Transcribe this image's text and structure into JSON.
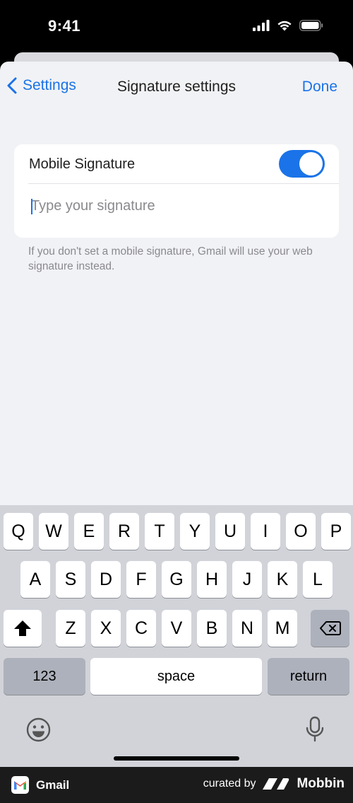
{
  "status_bar": {
    "time": "9:41"
  },
  "nav": {
    "back_label": "Settings",
    "title": "Signature settings",
    "done_label": "Done"
  },
  "signature": {
    "toggle_label": "Mobile Signature",
    "toggle_on": true,
    "input_value": "",
    "input_placeholder": "Type your signature",
    "helper_text": "If you don't set a mobile signature, Gmail will use your web signature instead."
  },
  "keyboard": {
    "row1": [
      "Q",
      "W",
      "E",
      "R",
      "T",
      "Y",
      "U",
      "I",
      "O",
      "P"
    ],
    "row2": [
      "A",
      "S",
      "D",
      "F",
      "G",
      "H",
      "J",
      "K",
      "L"
    ],
    "row3": [
      "Z",
      "X",
      "C",
      "V",
      "B",
      "N",
      "M"
    ],
    "numbers_label": "123",
    "space_label": "space",
    "return_label": "return"
  },
  "footer": {
    "app_name": "Gmail",
    "curated_by": "curated by",
    "brand": "Mobbin"
  },
  "colors": {
    "accent": "#1a73e8",
    "sheet_bg": "#f1f2f5",
    "keyboard_bg": "#d1d3d9"
  }
}
